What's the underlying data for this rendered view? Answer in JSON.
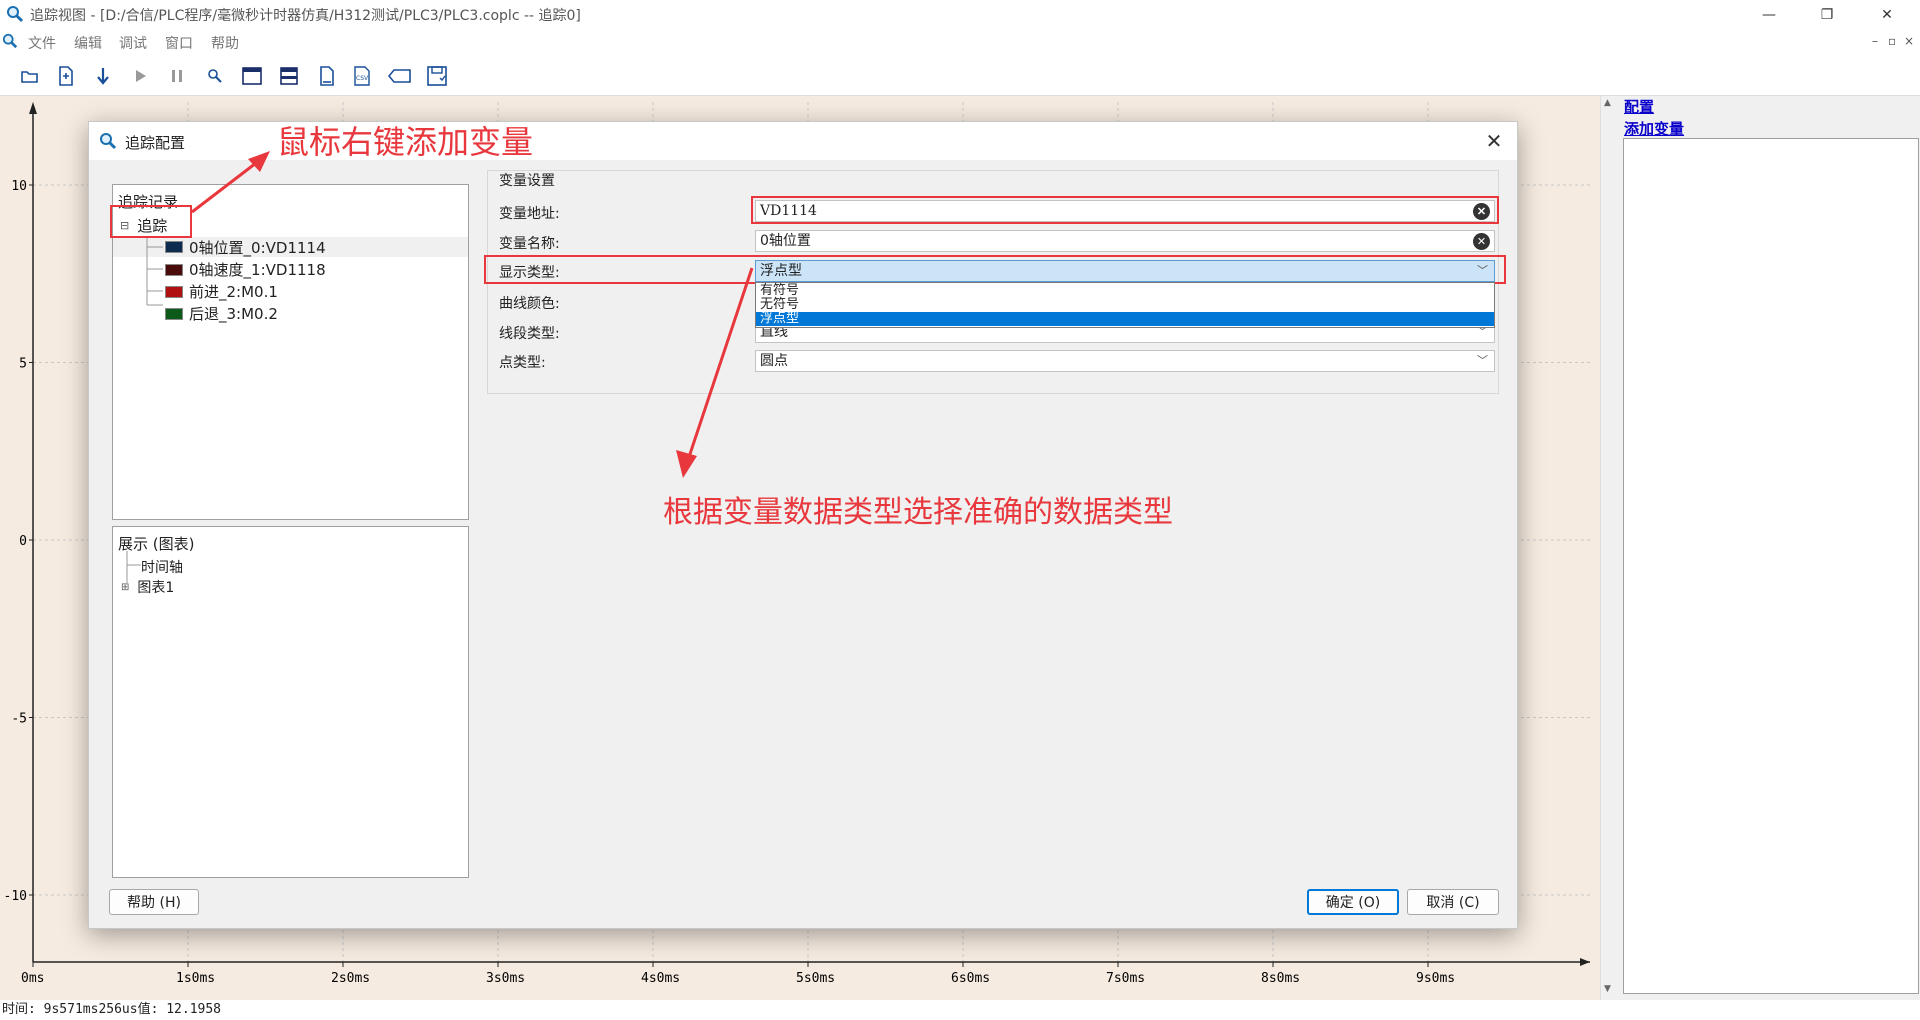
{
  "window": {
    "title": "追踪视图 - [D:/合信/PLC程序/毫微秒计时器仿真/H312测试/PLC3/PLC3.coplc -- 追踪0]",
    "minimize_label": "—",
    "maximize_label": "❐",
    "close_label": "✕"
  },
  "menu": [
    "文件",
    "编辑",
    "调试",
    "窗口",
    "帮助"
  ],
  "mdi_buttons": [
    "–",
    "▫",
    "×"
  ],
  "toolbar": [
    "open-icon",
    "new-icon",
    "download-icon",
    "play-icon",
    "pause-icon",
    "monitor-icon",
    "window-icon",
    "split-icon",
    "document-icon",
    "csv-icon",
    "tag-icon",
    "save-icon"
  ],
  "chart_data": {
    "type": "line",
    "title": "",
    "xlabel": "",
    "ylabel": "",
    "yticks": [
      "10",
      "5",
      "0",
      "-5",
      "-10"
    ],
    "xticks": [
      "0ms",
      "1s0ms",
      "2s0ms",
      "3s0ms",
      "4s0ms",
      "5s0ms",
      "6s0ms",
      "7s0ms",
      "8s0ms",
      "9s0ms"
    ],
    "ylim": [
      -12,
      12
    ],
    "grid": true,
    "series": []
  },
  "right_panel": {
    "link_config": "配置",
    "link_add_var": "添加变量"
  },
  "status": {
    "text": "时间: 9s571ms256us值: 12.1958"
  },
  "dialog": {
    "title": "追踪配置",
    "trace_panel": {
      "header": "追踪记录",
      "root": "追踪",
      "items": [
        {
          "label": "0轴位置_0:VD1114",
          "color": "#0d2a4f"
        },
        {
          "label": "0轴速度_1:VD1118",
          "color": "#4a0b0b"
        },
        {
          "label": "前进_2:M0.1",
          "color": "#b01010"
        },
        {
          "label": "后退_3:M0.2",
          "color": "#0b5a1a"
        }
      ]
    },
    "display_panel": {
      "header": "展示 (图表)",
      "items": [
        "时间轴",
        "图表1"
      ]
    },
    "settings": {
      "group_title": "变量设置",
      "address_label": "变量地址:",
      "address_value": "VD1114",
      "name_label": "变量名称:",
      "name_value": "0轴位置",
      "type_label": "显示类型:",
      "type_value": "浮点型",
      "type_options": [
        "有符号",
        "无符号",
        "浮点型"
      ],
      "color_label": "曲线颜色:",
      "line_label": "线段类型:",
      "line_value": "直线",
      "point_label": "点类型:",
      "point_value": "圆点"
    },
    "buttons": {
      "help": "帮助 (H)",
      "ok": "确定 (O)",
      "cancel": "取消 (C)"
    }
  },
  "annotations": {
    "top": "鼠标右键添加变量",
    "middle": "根据变量数据类型选择准确的数据类型"
  }
}
